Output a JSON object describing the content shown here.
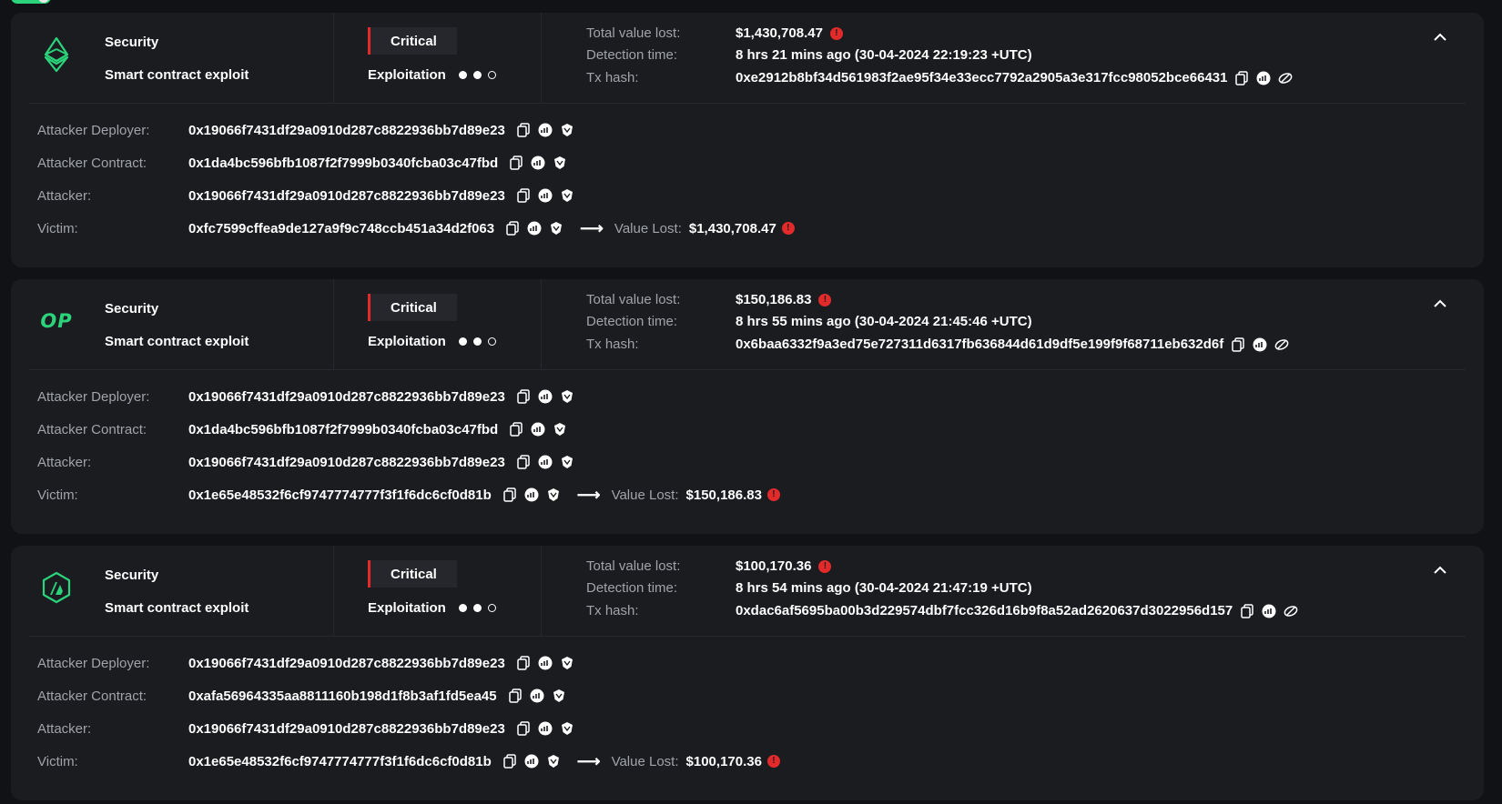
{
  "colors": {
    "accent_green": "#2bd47b",
    "critical_red": "#e22a2a",
    "background": "#111215",
    "card": "#1b1c20"
  },
  "incidents": [
    {
      "chain_icon": "ethereum-icon",
      "category": "Security",
      "type": "Smart contract exploit",
      "severity": "Critical",
      "stage": "Exploitation",
      "total_value_lost_label": "Total value lost:",
      "total_value_lost": "$1,430,708.47",
      "detection_time_label": "Detection time:",
      "detection_time": "8 hrs 21 mins ago (30-04-2024 22:19:23 +UTC)",
      "tx_hash_label": "Tx hash:",
      "tx_hash": "0xe2912b8bf34d561983f2ae95f34e33ecc7792a2905a3e317fcc98052bce66431",
      "attacker_deployer_label": "Attacker Deployer:",
      "attacker_deployer": "0x19066f7431df29a0910d287c8822936bb7d89e23",
      "attacker_contract_label": "Attacker Contract:",
      "attacker_contract": "0x1da4bc596bfb1087f2f7999b0340fcba03c47fbd",
      "attacker_label": "Attacker:",
      "attacker": "0x19066f7431df29a0910d287c8822936bb7d89e23",
      "victim_label": "Victim:",
      "victim": "0xfc7599cffea9de127a9f9c748ccb451a34d2f063",
      "value_lost_label": "Value Lost:",
      "value_lost": "$1,430,708.47"
    },
    {
      "chain_icon": "optimism-icon",
      "chain_text": "OP",
      "category": "Security",
      "type": "Smart contract exploit",
      "severity": "Critical",
      "stage": "Exploitation",
      "total_value_lost_label": "Total value lost:",
      "total_value_lost": "$150,186.83",
      "detection_time_label": "Detection time:",
      "detection_time": "8 hrs 55 mins ago (30-04-2024 21:45:46 +UTC)",
      "tx_hash_label": "Tx hash:",
      "tx_hash": "0x6baa6332f9a3ed75e727311d6317fb636844d61d9df5e199f9f68711eb632d6f",
      "attacker_deployer_label": "Attacker Deployer:",
      "attacker_deployer": "0x19066f7431df29a0910d287c8822936bb7d89e23",
      "attacker_contract_label": "Attacker Contract:",
      "attacker_contract": "0x1da4bc596bfb1087f2f7999b0340fcba03c47fbd",
      "attacker_label": "Attacker:",
      "attacker": "0x19066f7431df29a0910d287c8822936bb7d89e23",
      "victim_label": "Victim:",
      "victim": "0x1e65e48532f6cf9747774777f3f1f6dc6cf0d81b",
      "value_lost_label": "Value Lost:",
      "value_lost": "$150,186.83"
    },
    {
      "chain_icon": "arbitrum-icon",
      "category": "Security",
      "type": "Smart contract exploit",
      "severity": "Critical",
      "stage": "Exploitation",
      "total_value_lost_label": "Total value lost:",
      "total_value_lost": "$100,170.36",
      "detection_time_label": "Detection time:",
      "detection_time": "8 hrs 54 mins ago (30-04-2024 21:47:19 +UTC)",
      "tx_hash_label": "Tx hash:",
      "tx_hash": "0xdac6af5695ba00b3d229574dbf7fcc326d16b9f8a52ad2620637d3022956d157",
      "attacker_deployer_label": "Attacker Deployer:",
      "attacker_deployer": "0x19066f7431df29a0910d287c8822936bb7d89e23",
      "attacker_contract_label": "Attacker Contract:",
      "attacker_contract": "0xafa56964335aa8811160b198d1f8b3af1fd5ea45",
      "attacker_label": "Attacker:",
      "attacker": "0x19066f7431df29a0910d287c8822936bb7d89e23",
      "victim_label": "Victim:",
      "victim": "0x1e65e48532f6cf9747774777f3f1f6dc6cf0d81b",
      "value_lost_label": "Value Lost:",
      "value_lost": "$100,170.36"
    }
  ]
}
